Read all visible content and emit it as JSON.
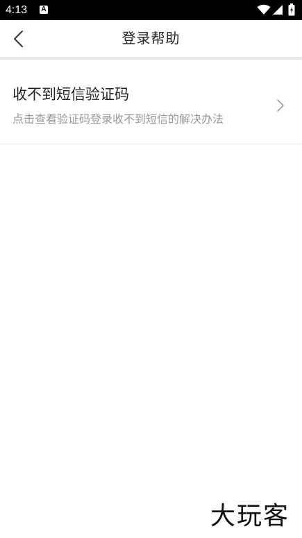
{
  "status_bar": {
    "time": "4:13",
    "notification_icon": "A",
    "icons": [
      "wifi-icon",
      "signal-icon",
      "battery-icon"
    ]
  },
  "nav": {
    "title": "登录帮助",
    "back_icon": "chevron-left-icon"
  },
  "help_items": [
    {
      "title": "收不到短信验证码",
      "subtitle": "点击查看验证码登录收不到短信的解决办法",
      "icon": "chevron-right-icon"
    }
  ],
  "watermark": "大玩客",
  "colors": {
    "background": "#ffffff",
    "status_bar": "#000000",
    "title_text": "#222222",
    "secondary_text": "#999999",
    "divider": "#ebebeb"
  }
}
